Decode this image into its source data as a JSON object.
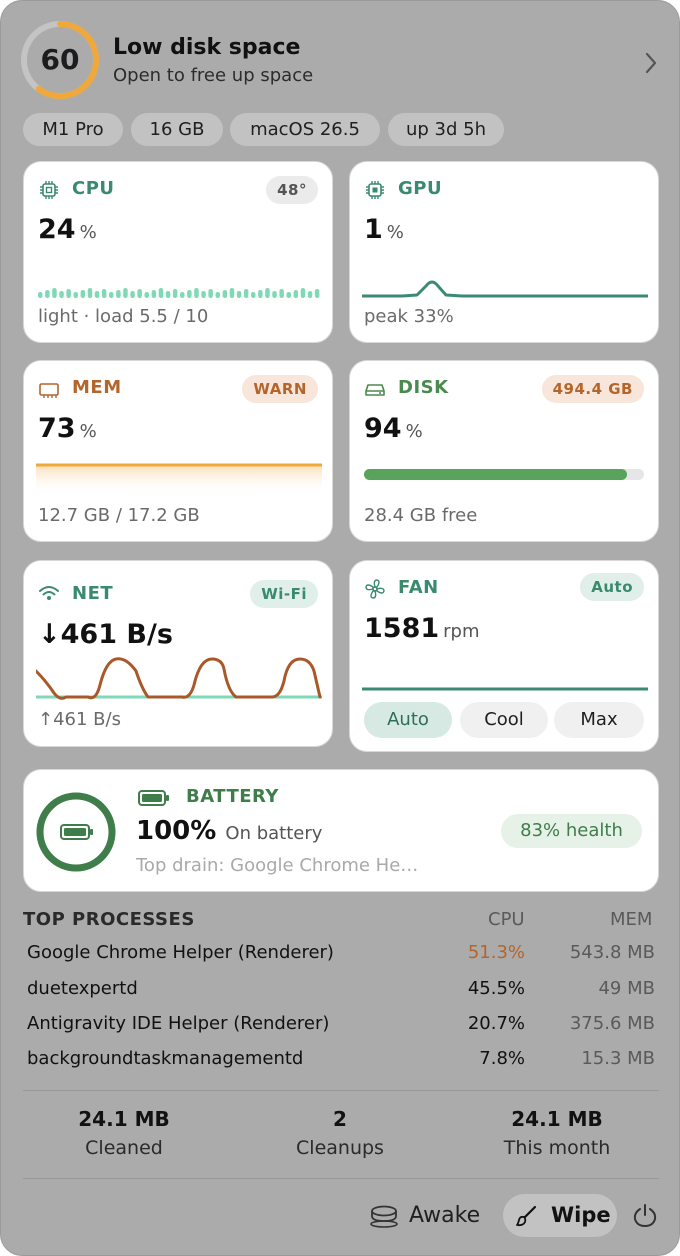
{
  "header": {
    "score": "60",
    "score_fraction": 0.6,
    "title": "Low disk space",
    "subtitle": "Open to free up space",
    "icons": {
      "ring": "health-score-ring",
      "chevron": "chevron-right-icon"
    }
  },
  "chips": [
    "M1 Pro",
    "16 GB",
    "macOS 26.5",
    "up 3d 5h"
  ],
  "cpu": {
    "title": "CPU",
    "badge": "48°",
    "value": "24",
    "unit": "%",
    "footer": "light · load 5.5 / 10",
    "icon": "cpu-chip-icon"
  },
  "gpu": {
    "title": "GPU",
    "value": "1",
    "unit": "%",
    "footer": "peak 33%",
    "icon": "gpu-chip-icon"
  },
  "mem": {
    "title": "MEM",
    "badge": "WARN",
    "value": "73",
    "unit": "%",
    "footer": "12.7 GB / 17.2 GB",
    "icon": "memory-icon"
  },
  "disk": {
    "title": "DISK",
    "badge": "494.4 GB",
    "value": "94",
    "unit": "%",
    "used_fraction": 0.94,
    "footer": "28.4 GB free",
    "icon": "disk-drive-icon"
  },
  "net": {
    "title": "NET",
    "badge": "Wi-Fi",
    "value": "↓461 B/s",
    "footer": "↑461 B/s",
    "icon": "wifi-icon"
  },
  "fan": {
    "title": "FAN",
    "badge": "Auto",
    "value": "1581",
    "unit": "rpm",
    "modes": [
      "Auto",
      "Cool",
      "Max"
    ],
    "active_mode": "Auto",
    "icon": "fan-icon"
  },
  "battery": {
    "title": "BATTERY",
    "value": "100%",
    "status": "On battery",
    "drain": "Top drain: Google Chrome He…",
    "health": "83% health",
    "level_fraction": 1.0,
    "icon": "battery-icon"
  },
  "processes": {
    "title": "TOP  PROCESSES",
    "col_cpu": "CPU",
    "col_mem": "MEM",
    "rows": [
      {
        "name": "Google Chrome Helper (Renderer)",
        "cpu": "51.3%",
        "mem": "543.8 MB"
      },
      {
        "name": "duetexpertd",
        "cpu": "45.5%",
        "mem": "49 MB"
      },
      {
        "name": "Antigravity IDE Helper (Renderer)",
        "cpu": "20.7%",
        "mem": "375.6 MB"
      },
      {
        "name": "backgroundtaskmanagementd",
        "cpu": "7.8%",
        "mem": "15.3 MB"
      }
    ]
  },
  "stats": [
    {
      "value": "24.1 MB",
      "label": "Cleaned"
    },
    {
      "value": "2",
      "label": "Cleanups"
    },
    {
      "value": "24.1 MB",
      "label": "This month"
    }
  ],
  "footer": {
    "awake_label": "Awake",
    "wipe_label": "Wipe",
    "icons": {
      "awake": "coffee-cup-icon",
      "wipe": "brush-icon",
      "power": "power-icon"
    }
  },
  "colors": {
    "green": "#3a8a6e",
    "orange": "#b4652b",
    "disk_green": "#5aa35c",
    "mem_line": "#f0a83a",
    "net_down": "#a8592a",
    "net_up": "#7fd9b6",
    "score_ring": "#f0a83a",
    "battery_ring": "#3f7d4a",
    "cpu_hot": "#b4652b"
  }
}
